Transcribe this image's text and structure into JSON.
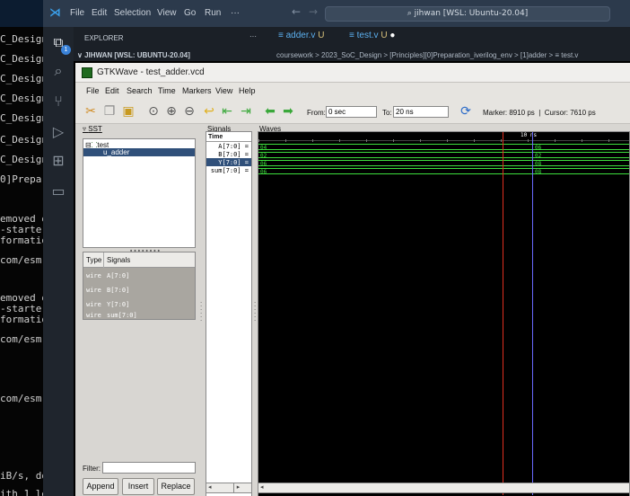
{
  "terminal": {
    "lines": [
      "C_Design",
      "C_Design",
      "C_Design",
      "C_Design",
      "C_Design",
      "C_Design",
      "C_Design",
      "0]Prepara",
      "",
      "",
      "emoved o",
      "-starte",
      "formatio",
      "",
      "com/esm",
      "",
      "",
      "emoved o",
      "-starte",
      "formatio",
      "",
      "com/esm",
      "",
      "",
      "",
      "",
      "com/esm",
      "",
      "",
      "",
      "",
      "iB/s, do",
      "ith 1 le"
    ]
  },
  "vscode": {
    "menu": [
      "File",
      "Edit",
      "Selection",
      "View",
      "Go",
      "Run",
      "···"
    ],
    "search": "jihwan [WSL: Ubuntu-20.04]",
    "explorer_title": "EXPLORER",
    "explorer_more": "···",
    "workspace": "JIHWAN [WSL: UBUNTU-20.04]",
    "tabs": [
      {
        "label": "adder.v",
        "status": "U"
      },
      {
        "label": "test.v",
        "status": "U"
      }
    ],
    "breadcrumb": "coursework > 2023_SoC_Design > [Principles][0]Preparation_iverilog_env > [1]adder > ≡ test.v",
    "notification_count": "1"
  },
  "gtkwave": {
    "title": "GTKWave - test_adder.vcd",
    "menu": [
      "File",
      "Edit",
      "Search",
      "Time",
      "Markers",
      "View",
      "Help"
    ],
    "from_label": "From:",
    "from_value": "0 sec",
    "to_label": "To:",
    "to_value": "20 ns",
    "marker_text": "Marker: 8910 ps  |  Cursor: 7610 ps",
    "sst_label": "SST",
    "tree": [
      {
        "label": "test"
      },
      {
        "label": "u_adder"
      }
    ],
    "type_header": "Type",
    "signals_header": "Signals",
    "signal_rows": [
      {
        "type": "wire",
        "name": "A[7:0]"
      },
      {
        "type": "wire",
        "name": "B[7:0]"
      },
      {
        "type": "wire",
        "name": "Y[7:0]"
      },
      {
        "type": "wire",
        "name": "sum[7:0]"
      }
    ],
    "filter_label": "Filter:",
    "buttons": {
      "append": "Append",
      "insert": "Insert",
      "replace": "Replace"
    },
    "signals_pane_title": "Signals",
    "waves_pane_title": "Waves",
    "time_label": "Time",
    "wave_signals": [
      {
        "name": "A[7:0] =",
        "v1": "04",
        "v2": "06"
      },
      {
        "name": "B[7:0] =",
        "v1": "02",
        "v2": "02"
      },
      {
        "name": "Y[7:0] =",
        "v1": "06",
        "v2": "08"
      },
      {
        "name": "sum[7:0] =",
        "v1": "06",
        "v2": "08"
      }
    ],
    "timescale_label": "10 ns",
    "colors": {
      "wave": "#3ee03e",
      "marker": "#e03020",
      "cursor": "#6a6aff",
      "highlight": "#30507a"
    }
  }
}
